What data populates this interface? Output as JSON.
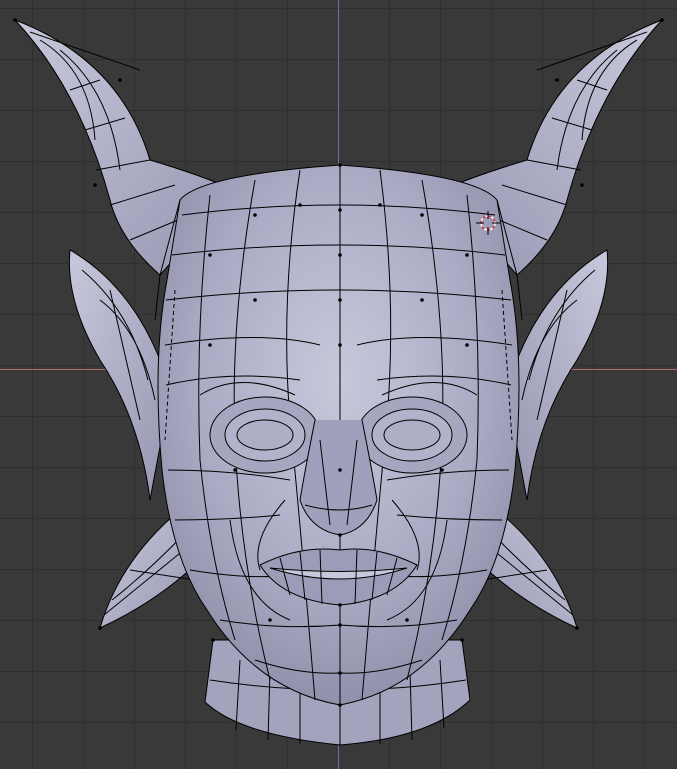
{
  "viewport": {
    "background_color": "#393939",
    "grid_color": "#2f2f2f",
    "x_axis_color": "#b06a6a",
    "z_axis_color": "#7a6aa8"
  },
  "model": {
    "fill_color": "#aaaac4",
    "shadow_color": "#8a8aa6",
    "highlight_color": "#c8c8dc",
    "wire_color": "#000000"
  },
  "cursor": {
    "icon": "3d-cursor-icon",
    "ring_color_a": "#ffffff",
    "ring_color_b": "#e03030"
  }
}
